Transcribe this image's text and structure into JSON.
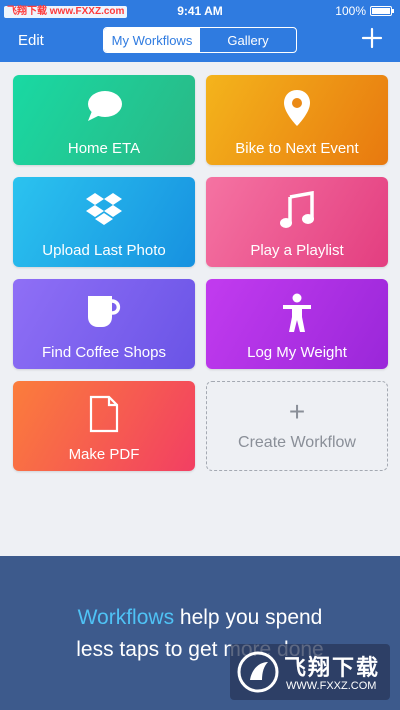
{
  "status_bar": {
    "watermark": "飞翔下载 www.FXXZ.com",
    "time": "9:41 AM",
    "battery": "100%"
  },
  "nav": {
    "edit_label": "Edit",
    "tabs": [
      {
        "label": "My Workflows",
        "active": true
      },
      {
        "label": "Gallery",
        "active": false
      }
    ],
    "add_icon": "plus-icon"
  },
  "tiles": [
    {
      "label": "Home ETA",
      "icon": "speech-bubble-icon"
    },
    {
      "label": "Bike to Next Event",
      "icon": "location-pin-icon"
    },
    {
      "label": "Upload Last Photo",
      "icon": "dropbox-icon"
    },
    {
      "label": "Play a Playlist",
      "icon": "music-note-icon"
    },
    {
      "label": "Find Coffee Shops",
      "icon": "coffee-cup-icon"
    },
    {
      "label": "Log My Weight",
      "icon": "person-icon"
    },
    {
      "label": "Make PDF",
      "icon": "document-icon"
    }
  ],
  "create": {
    "plus": "+",
    "label": "Create Workflow"
  },
  "promo": {
    "highlight": "Workflows",
    "line1_rest": " help you spend",
    "line2": "less taps to get more done"
  },
  "logo_watermark": {
    "big": "飞翔下载",
    "small": "WWW.FXXZ.COM"
  },
  "colors": {
    "nav": "#2f7be0",
    "panel": "#3d5a8c",
    "highlight": "#4fc2f5"
  }
}
